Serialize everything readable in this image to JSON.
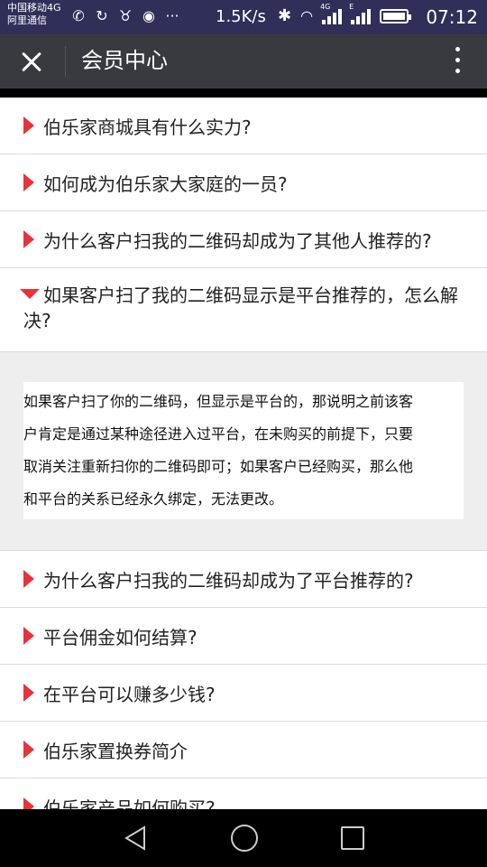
{
  "status_bar": {
    "carrier_line1": "中国移动4G",
    "carrier_line2": "阿里通信",
    "notification_icons": [
      "phone-icon",
      "sync-icon",
      "cow-icon",
      "browser-icon",
      "more-dots-icon"
    ],
    "net_speed": "1.5K/s",
    "clock": "07:12",
    "network_label_1": "4G",
    "network_label_2": "E"
  },
  "header": {
    "title": "会员中心",
    "close_icon": "close-icon",
    "more_icon": "more-vertical-icon"
  },
  "faq": {
    "items_before": [
      {
        "question": "伯乐家商城具有什么实力?"
      },
      {
        "question": "如何成为伯乐家大家庭的一员?"
      },
      {
        "question": "为什么客户扫我的二维码却成为了其他人推荐的?"
      }
    ],
    "open_item": {
      "question": "如果客户扫了我的二维码显示是平台推荐的，怎么解决?",
      "answer_lines": [
        "如果客户扫了你的二维码，但显示是平台的，那说明之前该客",
        "户肯定是通过某种途径进入过平台，在未购买的前提下，只要",
        "取消关注重新扫你的二维码即可；如果客户已经购买，那么他",
        "和平台的关系已经永久绑定，无法更改。"
      ]
    },
    "items_after": [
      {
        "question": "为什么客户扫我的二维码却成为了平台推荐的?"
      },
      {
        "question": "平台佣金如何结算?"
      },
      {
        "question": "在平台可以赚多少钱?"
      },
      {
        "question": "伯乐家置换券简介"
      },
      {
        "question": "伯乐家产品如何购买?"
      }
    ],
    "accent_color": "#e8323c"
  },
  "nav_bar": {
    "icons": [
      "back-triangle-icon",
      "home-circle-icon",
      "recent-square-icon"
    ]
  }
}
